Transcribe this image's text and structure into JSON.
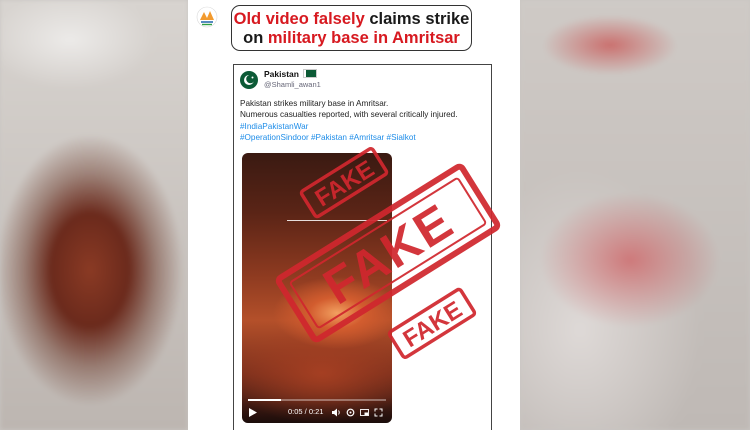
{
  "headline": {
    "part1_red": "Old video falsely",
    "part1_black": " claims strike",
    "part2_black": "on ",
    "part2_red": "military base in Amritsar"
  },
  "tweet": {
    "account_name": "Pakistan",
    "handle": "@Shamli_awan1",
    "lines": [
      "Pakistan strikes military base in Amritsar.",
      "Numerous casualties reported, with several critically injured."
    ],
    "hashtags_line1": "#IndiaPakistanWar",
    "hashtags_line2": "#OperationSindoor #Pakistan #Amritsar #Sialkot"
  },
  "video": {
    "time": "0:05 / 0:21",
    "progress": 0.24
  },
  "stamp": {
    "top_text": "FAKE",
    "center_text": "FAKE",
    "bottom_text": "FAKE",
    "color": "#d0272e"
  },
  "colors": {
    "accent_red": "#d71920",
    "hashtag_blue": "#1d8ce8"
  }
}
